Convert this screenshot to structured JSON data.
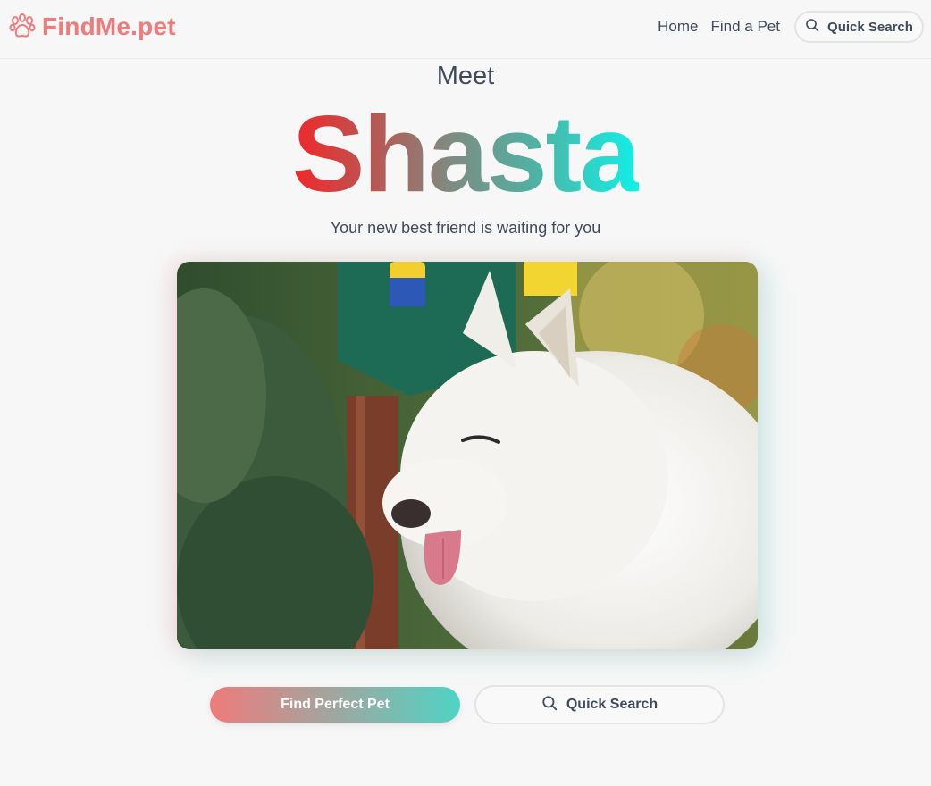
{
  "brand": {
    "name": "FindMe.pet",
    "icon": "paw-icon",
    "color": "#ef7b7b"
  },
  "nav": {
    "links": [
      "Home",
      "Find a Pet"
    ],
    "quick_search_label": "Quick Search",
    "quick_search_icon": "search-icon"
  },
  "hero": {
    "meet": "Meet",
    "pet_name": "Shasta",
    "tagline": "Your new best friend is waiting for you",
    "gradient_colors": [
      "#f2272a",
      "#10f0e6"
    ]
  },
  "photo": {
    "subject": "white fluffy dog photo"
  },
  "actions": {
    "primary_label": "Find Perfect Pet",
    "secondary_label": "Quick Search",
    "secondary_icon": "search-icon"
  }
}
